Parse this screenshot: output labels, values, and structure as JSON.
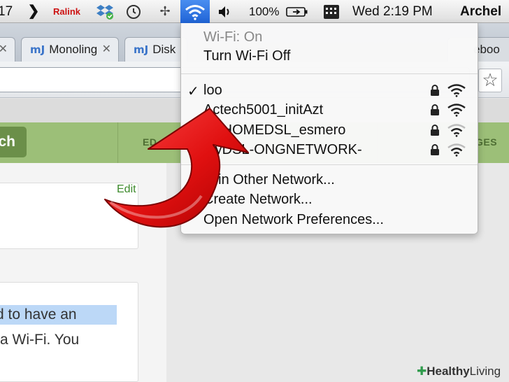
{
  "menubar": {
    "date_fragment": "17",
    "ralink": "Ralink",
    "battery": "100%",
    "clock": "Wed 2:19 PM",
    "user": "Archel"
  },
  "tabs": [
    {
      "icon": "mJ",
      "label": "Monoling"
    },
    {
      "icon": "mJ",
      "label": "Disk"
    },
    {
      "icon": "",
      "label": "eboo"
    }
  ],
  "site": {
    "search_label": "ch",
    "nav_left": "ED",
    "nav_right": "GES",
    "edit_link": "Edit",
    "article_line1": "d to have an",
    "article_line2": "a Wi-Fi. You"
  },
  "wifi_menu": {
    "status": "Wi-Fi: On",
    "toggle": "Turn Wi-Fi Off",
    "networks": [
      {
        "name": "loo",
        "selected": true,
        "locked": true,
        "strength": 3
      },
      {
        "name": "Actech5001_initAzt",
        "selected": false,
        "locked": true,
        "strength": 3
      },
      {
        "name": "myHOMEDSL_esmero",
        "selected": false,
        "locked": true,
        "strength": 2
      },
      {
        "name": "MyDSL-ONGNETWORK-",
        "selected": false,
        "locked": true,
        "strength": 2
      }
    ],
    "check_mark": "✓",
    "join_other": "Join Other Network...",
    "create": "Create Network...",
    "preferences": "Open Network Preferences..."
  },
  "watermark": {
    "part1": "Healthy",
    "part2": "Living"
  },
  "colors": {
    "wifi_highlight": "#2b6fe0",
    "site_nav": "#9cbf78",
    "search_button": "#6b8f49",
    "arrow_red": "#e01010",
    "edit_link": "#3d8a2c",
    "text_highlight": "#bcd8f7"
  },
  "icons": {
    "chevron": "chevron-right-icon",
    "dropbox": "dropbox-icon",
    "time_machine": "time-machine-icon",
    "bluetooth": "bluetooth-icon",
    "wifi": "wifi-icon",
    "volume": "speaker-icon",
    "battery": "battery-charging-icon",
    "input": "keyboard-input-icon",
    "bookmark": "star-icon",
    "lock": "lock-icon",
    "signal": "wifi-signal-icon",
    "arrow": "red-curved-arrow"
  }
}
